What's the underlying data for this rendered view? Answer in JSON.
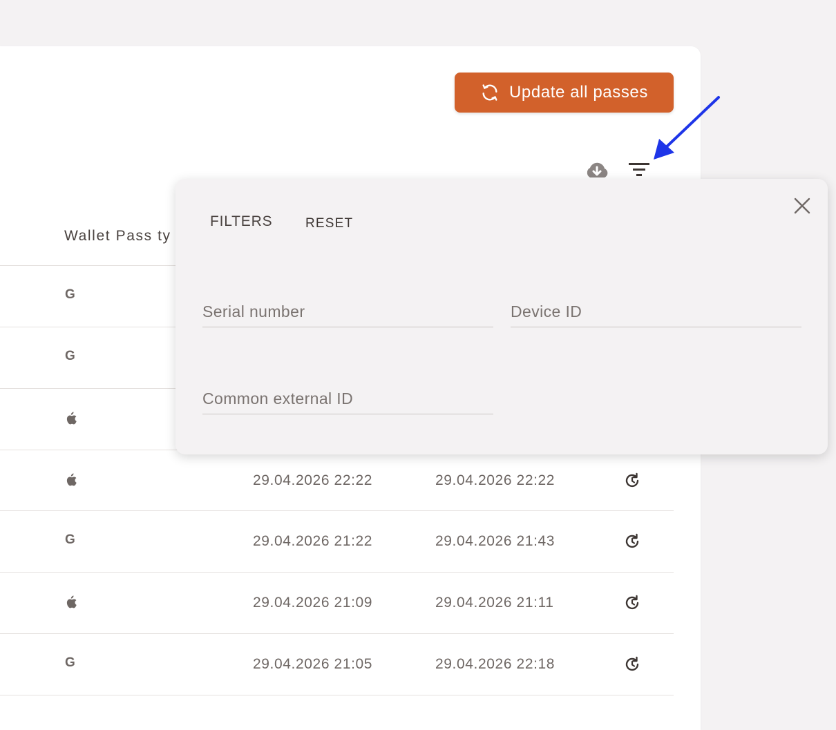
{
  "toolbar": {
    "update_label": "Update all passes",
    "accent_color": "#d2612b",
    "download_icon": "cloud-download-icon",
    "filter_icon": "filter-icon"
  },
  "table": {
    "headers": [
      "Wallet Pass ty"
    ],
    "rows": [
      {
        "type": "google",
        "created": "",
        "updated": ""
      },
      {
        "type": "google",
        "created": "",
        "updated": ""
      },
      {
        "type": "apple",
        "created": "",
        "updated": ""
      },
      {
        "type": "apple",
        "created": "29.04.2026 22:22",
        "updated": "29.04.2026 22:22"
      },
      {
        "type": "google",
        "created": "29.04.2026 21:22",
        "updated": "29.04.2026 21:43"
      },
      {
        "type": "apple",
        "created": "29.04.2026 21:09",
        "updated": "29.04.2026 21:11"
      },
      {
        "type": "google",
        "created": "29.04.2026 21:05",
        "updated": "29.04.2026 22:18"
      }
    ]
  },
  "filters": {
    "title": "FILTERS",
    "reset_label": "RESET",
    "serial_placeholder": "Serial number",
    "device_placeholder": "Device ID",
    "external_placeholder": "Common external ID",
    "serial_value": "",
    "device_value": "",
    "external_value": ""
  },
  "annotation": {
    "arrow_color": "#1e35e8"
  }
}
